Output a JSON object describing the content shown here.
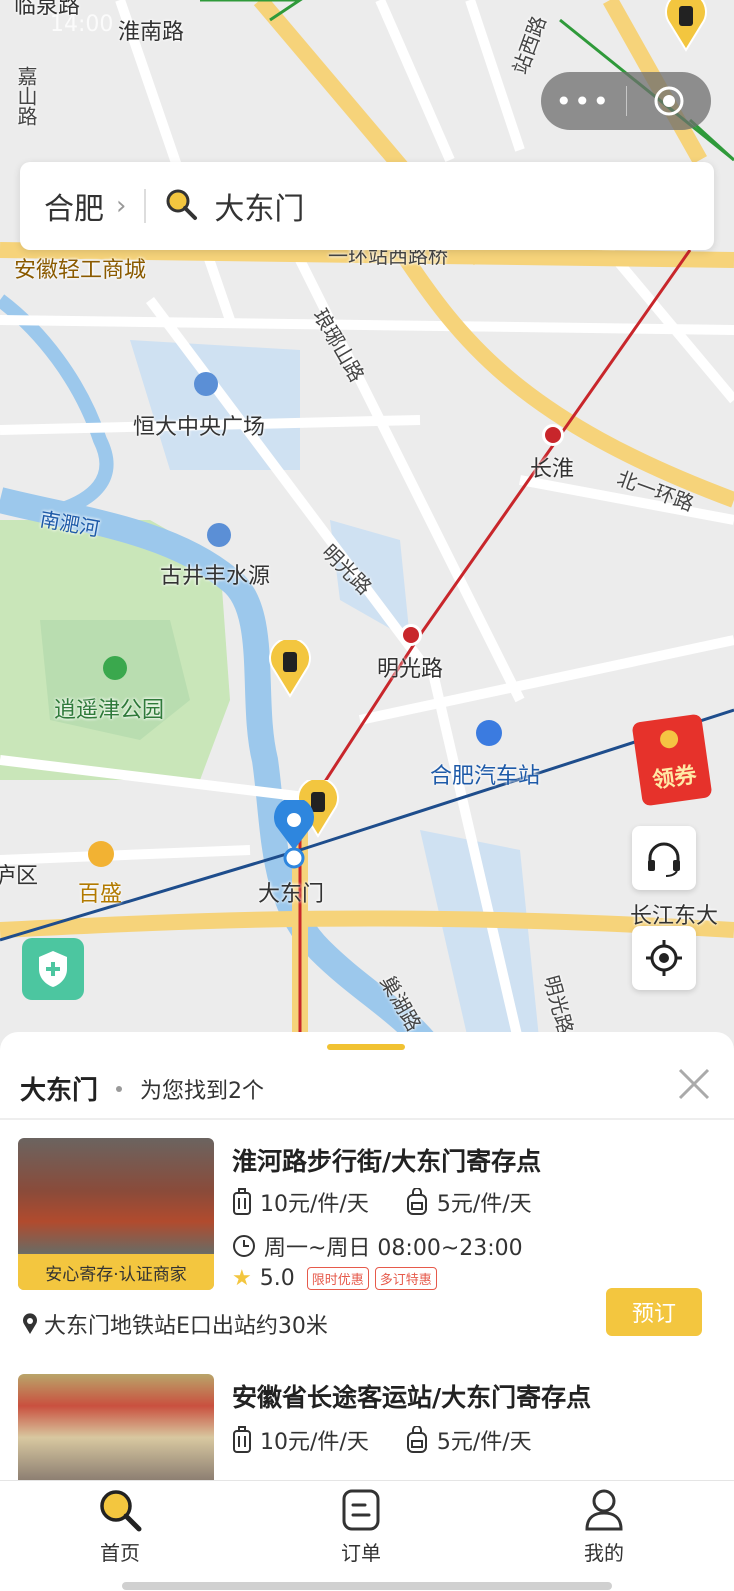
{
  "status_bar": {
    "time": "14:00"
  },
  "capsule": {
    "more": "•••"
  },
  "search": {
    "city": "合肥",
    "query": "大东门"
  },
  "map_labels": {
    "huainan_road": "淮南路",
    "linquan_road": "临泉路",
    "jiashan_road": "嘉山路",
    "zhanxi_road": "站西路",
    "qinggong": "安徽轻工商城",
    "erhuan": "一环站西路桥",
    "langya_road": "琅琊山路",
    "hengda": "恒大中央广场",
    "changhuai": "长淮",
    "beiyihuan": "北一环路",
    "nanfei_river": "南淝河",
    "gujing": "古井丰水源",
    "mingguang_road_diag": "明光路",
    "mingguang_station": "明光路",
    "xiaoyaojin": "逍遥津公园",
    "bus_station": "合肥汽车站",
    "baisheng": "百盛",
    "dadongmen": "大东门",
    "district": "庐区",
    "changjiang": "长江东大",
    "chaohu_road": "巢湖路",
    "mingguang_road_s": "明光路"
  },
  "coupon": {
    "label": "领券"
  },
  "sheet": {
    "title": "大东门",
    "found": "为您找到2个"
  },
  "stores": [
    {
      "name": "淮河路步行街/大东门寄存点",
      "suitcase_price": "10元/件/天",
      "bag_price": "5元/件/天",
      "hours": "周一~周日 08:00~23:00",
      "rating": "5.0",
      "tags": [
        "限时优惠",
        "多订特惠"
      ],
      "badge": "安心寄存·认证商家",
      "address": "大东门地铁站E口出站约30米",
      "book": "预订"
    },
    {
      "name": "安徽省长途客运站/大东门寄存点",
      "suitcase_price": "10元/件/天",
      "bag_price": "5元/件/天"
    }
  ],
  "tabbar": {
    "home": "首页",
    "orders": "订单",
    "mine": "我的"
  },
  "colors": {
    "accent": "#f3c63f",
    "metro_red": "#c8262b",
    "metro_blue": "#1e4d8c",
    "river": "#9cc8ec",
    "park": "#c9e6b9"
  }
}
